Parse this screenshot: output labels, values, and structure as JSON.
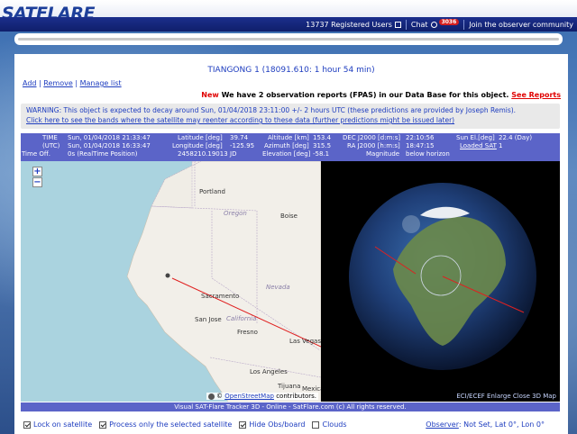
{
  "header": {
    "logo": "SATFLARE",
    "registered_users": "13737 Registered Users",
    "chat_label": "Chat",
    "chat_badge": "3036",
    "join": "Join the observer community"
  },
  "satellite": {
    "title": "TIANGONG 1 (18091.610: 1 hour 54 min)"
  },
  "actions": {
    "add": "Add",
    "remove": "Remove",
    "manage": "Manage list",
    "sep": "|"
  },
  "news": {
    "new_label": "New",
    "text": "We have 2 observation reports (FPAS) in our Data Base for this object.",
    "see_reports": "See Reports"
  },
  "warning": {
    "line1": "WARNING: This object is expected to decay around Sun, 01/04/2018 23:11:00 +/- 2 hours UTC (these predictions are provided by Joseph Remis).",
    "line2": "Click here to see the bands where the satellite may reenter according to these data (further predictions might be issued later)"
  },
  "info": {
    "time_label": "TIME",
    "time_value": "Sun, 01/04/2018 21:33:47",
    "utc_label": "(UTC)",
    "utc_value": "Sun, 01/04/2018 16:33:47",
    "timeoff_label": "Time Off.",
    "timeoff_value": "0s (RealTime Position)",
    "lat_label": "Latitude [deg]",
    "lat_value": "39.74",
    "lon_label": "Longitude [deg]",
    "lon_value": "-125.95",
    "jd_value": "2458210.19013",
    "jd_label": "JD",
    "alt_label": "Altitude [km]",
    "alt_value": "153.4",
    "az_label": "Azimuth [deg]",
    "az_value": "315.5",
    "el_label": "Elevation [deg]",
    "el_value": "-58.1",
    "dec_label": "DEC J2000 [d:m:s]",
    "dec_value": "22:10:56",
    "ra_label": "RA J2000 [h:m:s]",
    "ra_value": "18:47:15",
    "mag_label": "Magnitude",
    "mag_value": "below horizon",
    "sunel_label": "Sun El.[deg]",
    "sunel_value": "22.4 (Day)",
    "loaded_label": "Loaded SAT",
    "loaded_value": "1"
  },
  "map": {
    "zoom_in": "+",
    "zoom_out": "−",
    "labels": {
      "portland": "Portland",
      "oregon": "Oregon",
      "boise": "Boise",
      "sacramento": "Sacramento",
      "nevada": "Nevada",
      "sanjose": "San Jose",
      "california": "California",
      "fresno": "Fresno",
      "lasvegas": "Las Vegas",
      "losangeles": "Los Angeles",
      "tijuana": "Tijuana",
      "mexicali": "Mexical"
    },
    "attribution_prefix": "©",
    "attribution_link": "OpenStreetMap",
    "attribution_suffix": "contributors."
  },
  "globe": {
    "bar_text": "ECI/ECEF  Enlarge  Close 3D Map"
  },
  "footer": {
    "text": "Visual SAT-Flare Tracker 3D - Online - SatFlare.com (c) All rights reserved."
  },
  "options": {
    "lock": "Lock on satellite",
    "process": "Process only the selected satellite",
    "hide": "Hide Obs/board",
    "clouds": "Clouds"
  },
  "observer": {
    "label": "Observer",
    "value": ": Not Set, Lat 0°, Lon 0°"
  },
  "colors": {
    "nav": "#0f1f6b",
    "info_bg": "#5b64c8",
    "link": "#1d3cbf",
    "alert": "#e00000",
    "track": "#e02020"
  }
}
